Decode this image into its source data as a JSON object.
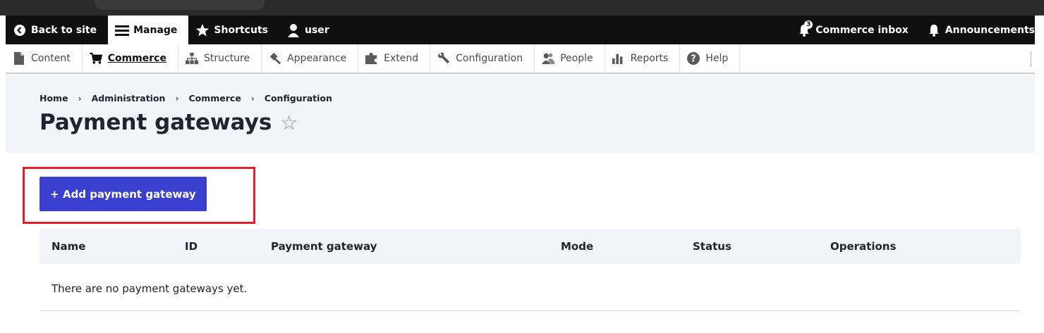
{
  "toolbar": {
    "back": "Back to site",
    "manage": "Manage",
    "shortcuts": "Shortcuts",
    "user": "user",
    "inbox": "Commerce inbox",
    "inbox_count": "3",
    "announcements": "Announcements"
  },
  "tray": {
    "items": [
      {
        "label": "Content",
        "icon": "file-icon"
      },
      {
        "label": "Commerce",
        "icon": "cart-icon"
      },
      {
        "label": "Structure",
        "icon": "sitemap-icon"
      },
      {
        "label": "Appearance",
        "icon": "paint-icon"
      },
      {
        "label": "Extend",
        "icon": "puzzle-icon"
      },
      {
        "label": "Configuration",
        "icon": "wrench-icon"
      },
      {
        "label": "People",
        "icon": "people-icon"
      },
      {
        "label": "Reports",
        "icon": "bar-chart-icon"
      },
      {
        "label": "Help",
        "icon": "help-icon"
      }
    ]
  },
  "breadcrumb": [
    "Home",
    "Administration",
    "Commerce",
    "Configuration"
  ],
  "page_title": "Payment gateways",
  "add_button": "+ Add payment gateway",
  "table": {
    "columns": [
      "Name",
      "ID",
      "Payment gateway",
      "Mode",
      "Status",
      "Operations"
    ],
    "empty_message": "There are no payment gateways yet."
  },
  "colors": {
    "accent": "#3b3fd0",
    "highlight": "#e0202c",
    "toolbar_bg": "#0f0f0f",
    "header_bg": "#f3f4f9"
  }
}
